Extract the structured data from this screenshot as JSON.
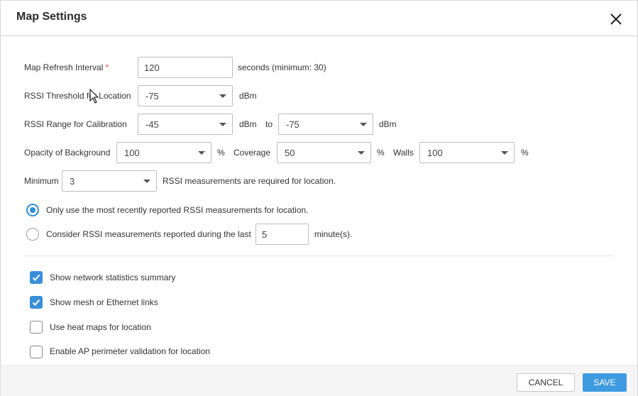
{
  "dialog": {
    "title": "Map Settings",
    "close_icon": "close-icon"
  },
  "refresh": {
    "label": "Map Refresh Interval",
    "required_mark": "*",
    "value": "120",
    "hint": "seconds (minimum: 30)"
  },
  "rssi_threshold": {
    "label": "RSSI Threshold for Location",
    "value": "-75",
    "unit": "dBm"
  },
  "rssi_range": {
    "label": "RSSI Range for Calibration",
    "from_value": "-45",
    "from_unit": "dBm",
    "to_label": "to",
    "to_value": "-75",
    "to_unit": "dBm"
  },
  "opacity": {
    "background_label": "Opacity of Background",
    "background_value": "100",
    "background_unit": "%",
    "coverage_label": "Coverage",
    "coverage_value": "50",
    "coverage_unit": "%",
    "walls_label": "Walls",
    "walls_value": "100",
    "walls_unit": "%"
  },
  "minimum": {
    "label": "Minimum",
    "value": "3",
    "suffix": "RSSI measurements are required for location."
  },
  "radios": {
    "option1": "Only use the most recently reported RSSI measurements for location.",
    "option1_selected": true,
    "option2_prefix": "Consider RSSI measurements reported during the last",
    "option2_value": "5",
    "option2_suffix": "minute(s).",
    "option2_selected": false
  },
  "checkboxes": [
    {
      "label": "Show network statistics summary",
      "checked": true
    },
    {
      "label": "Show mesh or Ethernet links",
      "checked": true
    },
    {
      "label": "Use heat maps for location",
      "checked": false
    },
    {
      "label": "Enable AP perimeter validation for location",
      "checked": false
    }
  ],
  "footer": {
    "cancel_label": "CANCEL",
    "save_label": "SAVE"
  },
  "colors": {
    "accent": "#3e9be0",
    "required": "#d9534f"
  }
}
